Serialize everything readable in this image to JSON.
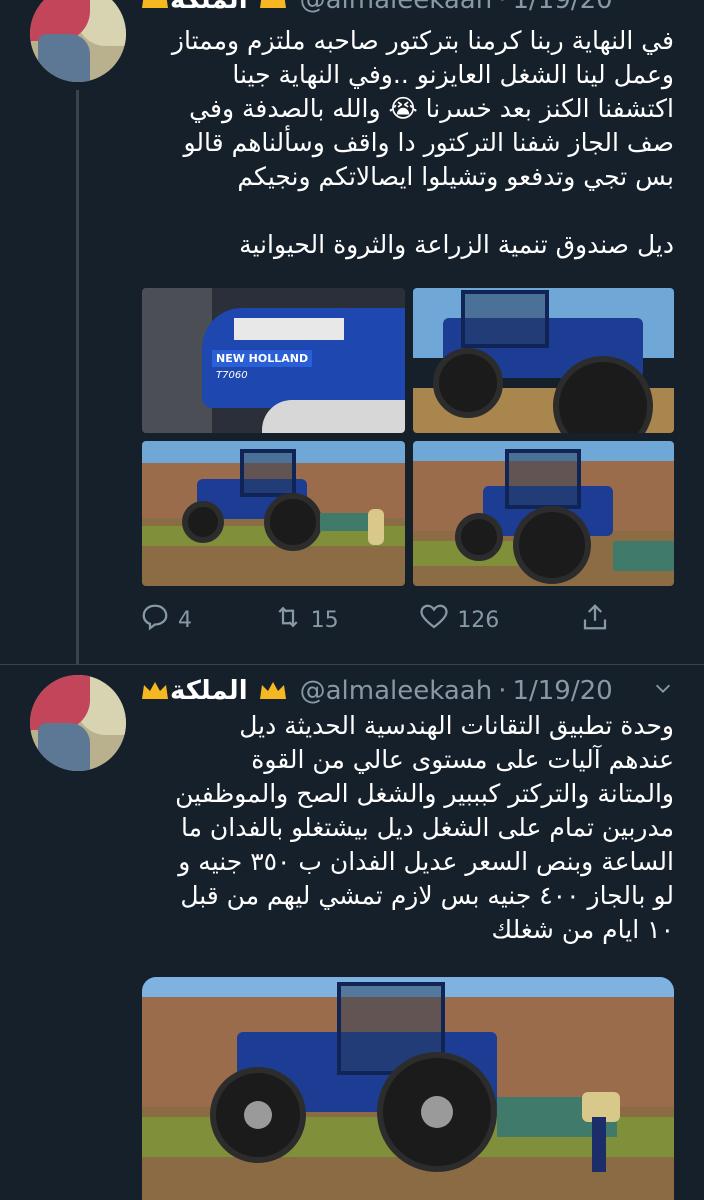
{
  "tweet1": {
    "name": "الملكة",
    "handle": "@almaleekaah",
    "date": "1/19/20",
    "lines": [
      "في النهاية ربنا كرمنا بتركتور صاحبه ملتزم وممتاز",
      "وعمل لينا الشغل العايزنو ..وفي النهاية جينا",
      "اكتشفنا الكنز بعد خسرنا 😭 والله بالصدفة وفي",
      "صف الجاز شفنا التركتور دا واقف وسألناهم قالو",
      "بس تجي وتدفعو وتشيلوا ايصالاتكم ونجيكم"
    ],
    "line_last": "ديل صندوق تنمية الزراعة والثروة الحيوانية",
    "image1_brand": "NEW HOLLAND",
    "image1_model": "T7060",
    "reply_count": "4",
    "retweet_count": "15",
    "like_count": "126"
  },
  "tweet2": {
    "name": "الملكة",
    "handle": "@almaleekaah",
    "date": "1/19/20",
    "lines": [
      "وحدة تطبيق التقانات الهندسية الحديثة ديل",
      "عندهم آليات على مستوى عالي من القوة",
      "والمتانة والتركتر كبببير والشغل الصح والموظفين",
      "مدربين تمام على الشغل ديل بيشتغلو بالفدان ما",
      "الساعة وبنص السعر عديل الفدان ب ٣٥٠ جنيه و",
      "لو بالجاز ٤٠٠ جنيه بس لازم تمشي ليهم من قبل",
      "١٠ ايام من شغلك"
    ]
  },
  "colors": {
    "background": "#15202b",
    "text": "#ffffff",
    "muted": "#8899a6",
    "divider": "#38444d"
  },
  "icons": [
    "reply-icon",
    "retweet-icon",
    "like-icon",
    "share-icon",
    "chevron-down-icon",
    "crown-icon"
  ]
}
